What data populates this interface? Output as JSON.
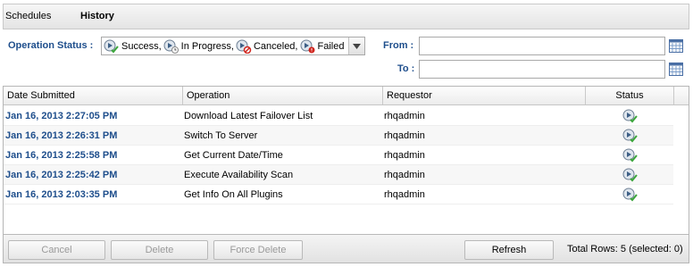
{
  "tabs": [
    {
      "label": "Schedules",
      "active": false
    },
    {
      "label": "History",
      "active": true
    }
  ],
  "filters": {
    "operation_status_label": "Operation Status :",
    "status_options": [
      {
        "label": "Success,",
        "icon": "success-icon"
      },
      {
        "label": "In Progress,",
        "icon": "in-progress-icon"
      },
      {
        "label": "Canceled,",
        "icon": "canceled-icon"
      },
      {
        "label": "Failed",
        "icon": "failed-icon"
      }
    ],
    "from_label": "From :",
    "to_label": "To :",
    "from_value": "",
    "to_value": ""
  },
  "table": {
    "columns": [
      "Date Submitted",
      "Operation",
      "Requestor",
      "Status"
    ],
    "rows": [
      {
        "date": "Jan 16, 2013 2:27:05 PM",
        "operation": "Download Latest Failover List",
        "requestor": "rhqadmin",
        "status": "success"
      },
      {
        "date": "Jan 16, 2013 2:26:31 PM",
        "operation": "Switch To Server",
        "requestor": "rhqadmin",
        "status": "success"
      },
      {
        "date": "Jan 16, 2013 2:25:58 PM",
        "operation": "Get Current Date/Time",
        "requestor": "rhqadmin",
        "status": "success"
      },
      {
        "date": "Jan 16, 2013 2:25:42 PM",
        "operation": "Execute Availability Scan",
        "requestor": "rhqadmin",
        "status": "success"
      },
      {
        "date": "Jan 16, 2013 2:03:35 PM",
        "operation": "Get Info On All Plugins",
        "requestor": "rhqadmin",
        "status": "success"
      }
    ]
  },
  "toolbar": {
    "cancel_label": "Cancel",
    "delete_label": "Delete",
    "force_delete_label": "Force Delete",
    "refresh_label": "Refresh",
    "total_rows": "Total Rows: 5 (selected: 0)"
  },
  "colors": {
    "label_blue": "#1e4e8c",
    "success_green": "#3aa53a",
    "failed_red": "#d0251e"
  }
}
